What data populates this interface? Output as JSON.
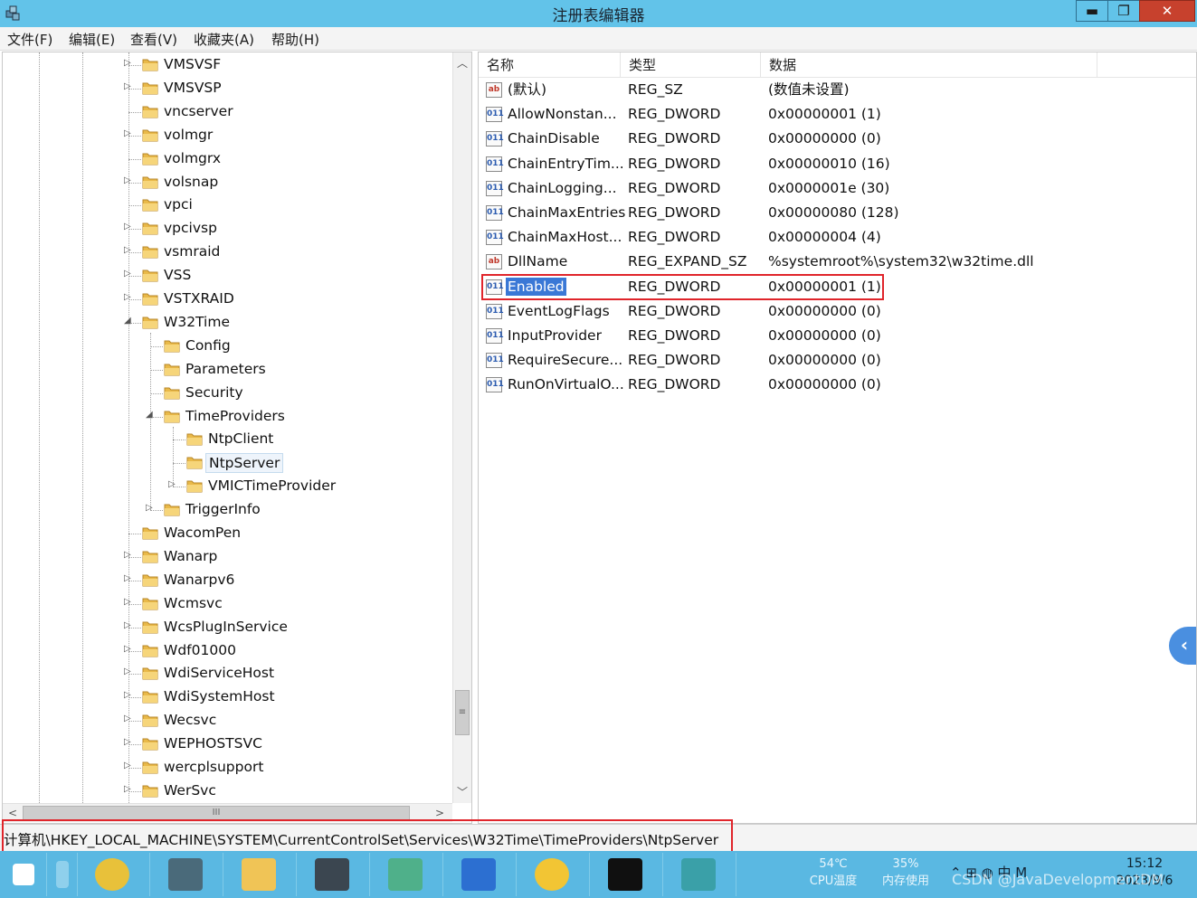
{
  "window": {
    "title": "注册表编辑器",
    "min_glyph": "▬",
    "max_glyph": "❐",
    "close_glyph": "✕"
  },
  "menu": [
    "文件(F)",
    "编辑(E)",
    "查看(V)",
    "收藏夹(A)",
    "帮助(H)"
  ],
  "tree": {
    "items": [
      {
        "label": "VMSVSF",
        "level": 0,
        "toggle": "▷"
      },
      {
        "label": "VMSVSP",
        "level": 0,
        "toggle": "▷"
      },
      {
        "label": "vncserver",
        "level": 0,
        "toggle": ""
      },
      {
        "label": "volmgr",
        "level": 0,
        "toggle": "▷"
      },
      {
        "label": "volmgrx",
        "level": 0,
        "toggle": ""
      },
      {
        "label": "volsnap",
        "level": 0,
        "toggle": "▷"
      },
      {
        "label": "vpci",
        "level": 0,
        "toggle": ""
      },
      {
        "label": "vpcivsp",
        "level": 0,
        "toggle": "▷"
      },
      {
        "label": "vsmraid",
        "level": 0,
        "toggle": "▷"
      },
      {
        "label": "VSS",
        "level": 0,
        "toggle": "▷"
      },
      {
        "label": "VSTXRAID",
        "level": 0,
        "toggle": "▷"
      },
      {
        "label": "W32Time",
        "level": 0,
        "toggle": "◢"
      },
      {
        "label": "Config",
        "level": 1,
        "toggle": ""
      },
      {
        "label": "Parameters",
        "level": 1,
        "toggle": ""
      },
      {
        "label": "Security",
        "level": 1,
        "toggle": ""
      },
      {
        "label": "TimeProviders",
        "level": 1,
        "toggle": "◢"
      },
      {
        "label": "NtpClient",
        "level": 2,
        "toggle": ""
      },
      {
        "label": "NtpServer",
        "level": 2,
        "toggle": "",
        "selected": true
      },
      {
        "label": "VMICTimeProvider",
        "level": 2,
        "toggle": "▷"
      },
      {
        "label": "TriggerInfo",
        "level": 1,
        "toggle": "▷"
      },
      {
        "label": "WacomPen",
        "level": 0,
        "toggle": ""
      },
      {
        "label": "Wanarp",
        "level": 0,
        "toggle": "▷"
      },
      {
        "label": "Wanarpv6",
        "level": 0,
        "toggle": "▷"
      },
      {
        "label": "Wcmsvc",
        "level": 0,
        "toggle": "▷"
      },
      {
        "label": "WcsPlugInService",
        "level": 0,
        "toggle": "▷"
      },
      {
        "label": "Wdf01000",
        "level": 0,
        "toggle": "▷"
      },
      {
        "label": "WdiServiceHost",
        "level": 0,
        "toggle": "▷"
      },
      {
        "label": "WdiSystemHost",
        "level": 0,
        "toggle": "▷"
      },
      {
        "label": "Wecsvc",
        "level": 0,
        "toggle": "▷"
      },
      {
        "label": "WEPHOSTSVC",
        "level": 0,
        "toggle": "▷"
      },
      {
        "label": "wercplsupport",
        "level": 0,
        "toggle": "▷"
      },
      {
        "label": "WerSvc",
        "level": 0,
        "toggle": "▷"
      }
    ],
    "scroll_up": "︿",
    "scroll_down": "﹀",
    "scroll_left": "<",
    "scroll_right": ">",
    "v_grip": "≡",
    "h_grip": "III"
  },
  "values": {
    "columns": {
      "name": "名称",
      "type": "类型",
      "data": "数据"
    },
    "rows": [
      {
        "icon": "ab",
        "name": "(默认)",
        "type": "REG_SZ",
        "data": "(数值未设置)"
      },
      {
        "icon": "011",
        "name": "AllowNonstan...",
        "type": "REG_DWORD",
        "data": "0x00000001 (1)"
      },
      {
        "icon": "011",
        "name": "ChainDisable",
        "type": "REG_DWORD",
        "data": "0x00000000 (0)"
      },
      {
        "icon": "011",
        "name": "ChainEntryTim...",
        "type": "REG_DWORD",
        "data": "0x00000010 (16)"
      },
      {
        "icon": "011",
        "name": "ChainLogging...",
        "type": "REG_DWORD",
        "data": "0x0000001e (30)"
      },
      {
        "icon": "011",
        "name": "ChainMaxEntries",
        "type": "REG_DWORD",
        "data": "0x00000080 (128)"
      },
      {
        "icon": "011",
        "name": "ChainMaxHost...",
        "type": "REG_DWORD",
        "data": "0x00000004 (4)"
      },
      {
        "icon": "ab",
        "name": "DllName",
        "type": "REG_EXPAND_SZ",
        "data": "%systemroot%\\system32\\w32time.dll"
      },
      {
        "icon": "011",
        "name": "Enabled",
        "type": "REG_DWORD",
        "data": "0x00000001 (1)",
        "selected": true
      },
      {
        "icon": "011",
        "name": "EventLogFlags",
        "type": "REG_DWORD",
        "data": "0x00000000 (0)"
      },
      {
        "icon": "011",
        "name": "InputProvider",
        "type": "REG_DWORD",
        "data": "0x00000000 (0)"
      },
      {
        "icon": "011",
        "name": "RequireSecure...",
        "type": "REG_DWORD",
        "data": "0x00000000 (0)"
      },
      {
        "icon": "011",
        "name": "RunOnVirtualO...",
        "type": "REG_DWORD",
        "data": "0x00000000 (0)"
      }
    ],
    "side_tab": "‹"
  },
  "status": {
    "path": "计算机\\HKEY_LOCAL_MACHINE\\SYSTEM\\CurrentControlSet\\Services\\W32Time\\TimeProviders\\NtpServer"
  },
  "taskbar": {
    "apps": [
      {
        "name": "start",
        "color": "#ffffff"
      },
      {
        "name": "search",
        "color": "#8fd0ec"
      },
      {
        "name": "chrome",
        "color": "#e8c13a"
      },
      {
        "name": "notepad",
        "color": "#4a6a7a"
      },
      {
        "name": "explorer",
        "color": "#f0c456"
      },
      {
        "name": "remote-desktop",
        "color": "#3b4650"
      },
      {
        "name": "server-manager",
        "color": "#4fb08a"
      },
      {
        "name": "vs",
        "color": "#2c6fd1"
      },
      {
        "name": "chat",
        "color": "#f2c534"
      },
      {
        "name": "cmd",
        "color": "#101010"
      },
      {
        "name": "regedit",
        "color": "#3aa0a8"
      }
    ],
    "temp_value": "54℃",
    "temp_label": "CPU温度",
    "mem_value": "35%",
    "mem_label": "内存使用",
    "tray_icons": "⌃ ⊞ ◍ 中 M",
    "time": "15:12",
    "date": "2023/9/6",
    "watermark": "CSDN @JavaDevelopmentDM"
  },
  "colors": {
    "titlebar": "#62c3e9",
    "selection": "#3a78d6",
    "highlight_box": "#e0252b",
    "taskbar": "#5ab8e2"
  }
}
